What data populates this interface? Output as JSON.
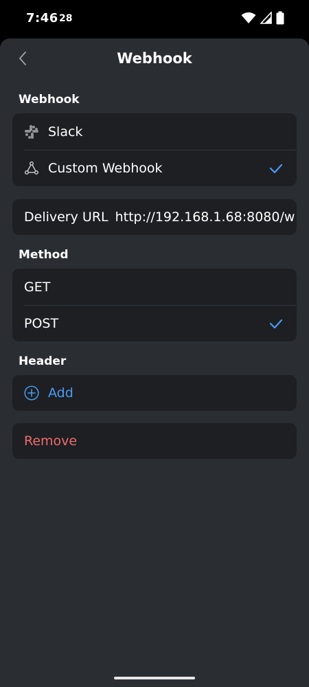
{
  "status_bar": {
    "time": "7:46",
    "date": "28",
    "icons": [
      "wifi-icon",
      "signal-icon",
      "battery-icon"
    ]
  },
  "header": {
    "title": "Webhook",
    "back_icon": "chevron-left-icon"
  },
  "webhook_section": {
    "label": "Webhook",
    "options": [
      {
        "label": "Slack",
        "icon": "slack-icon",
        "selected": false
      },
      {
        "label": "Custom Webhook",
        "icon": "webhook-icon",
        "selected": true
      }
    ]
  },
  "delivery_url": {
    "label": "Delivery URL",
    "value": "http://192.168.1.68:8080/w"
  },
  "method_section": {
    "label": "Method",
    "options": [
      {
        "label": "GET",
        "selected": false
      },
      {
        "label": "POST",
        "selected": true
      }
    ]
  },
  "header_section": {
    "label": "Header",
    "add_label": "Add",
    "add_icon": "plus-circle-icon"
  },
  "remove": {
    "label": "Remove"
  },
  "colors": {
    "accent": "#4b9cf5",
    "danger": "#ef6b6b",
    "background": "#2a2d32",
    "card": "#1d1f23"
  }
}
